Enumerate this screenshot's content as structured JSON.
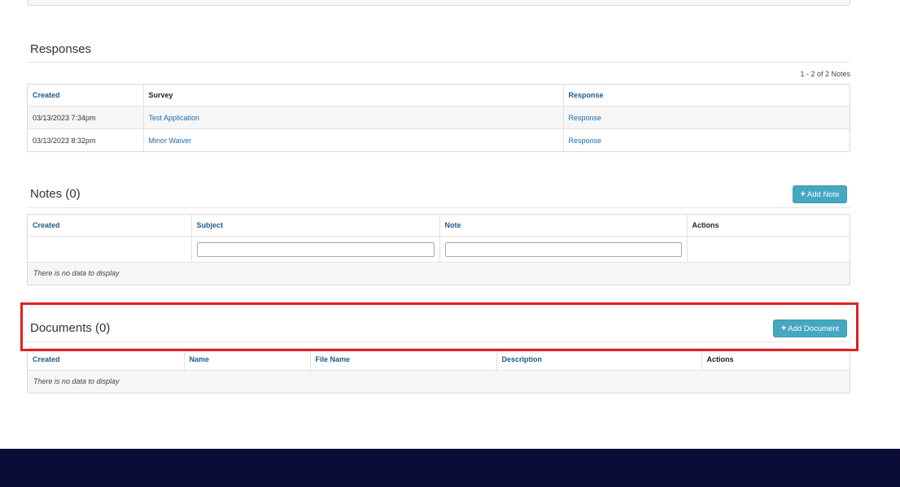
{
  "responses": {
    "title": "Responses",
    "count_label": "1 - 2 of 2 Notes",
    "columns": [
      "Created",
      "Survey",
      "Response"
    ],
    "rows": [
      {
        "created": "03/13/2023 7:34pm",
        "survey": "Test Application",
        "response": "Response"
      },
      {
        "created": "03/13/2023 8:32pm",
        "survey": "Minor Waiver",
        "response": "Response"
      }
    ]
  },
  "notes": {
    "title": "Notes (0)",
    "add_label": "Add Note",
    "columns": [
      "Created",
      "Subject",
      "Note",
      "Actions"
    ],
    "empty_text": "There is no data to display"
  },
  "documents": {
    "title": "Documents (0)",
    "add_label": "Add Document",
    "columns": [
      "Created",
      "Name",
      "File Name",
      "Description",
      "Actions"
    ],
    "empty_text": "There is no data to display"
  },
  "colors": {
    "accent_button": "#46a7c1",
    "link": "#1f6ca8",
    "footer": "#0b0c37",
    "highlight": "#e02020"
  }
}
